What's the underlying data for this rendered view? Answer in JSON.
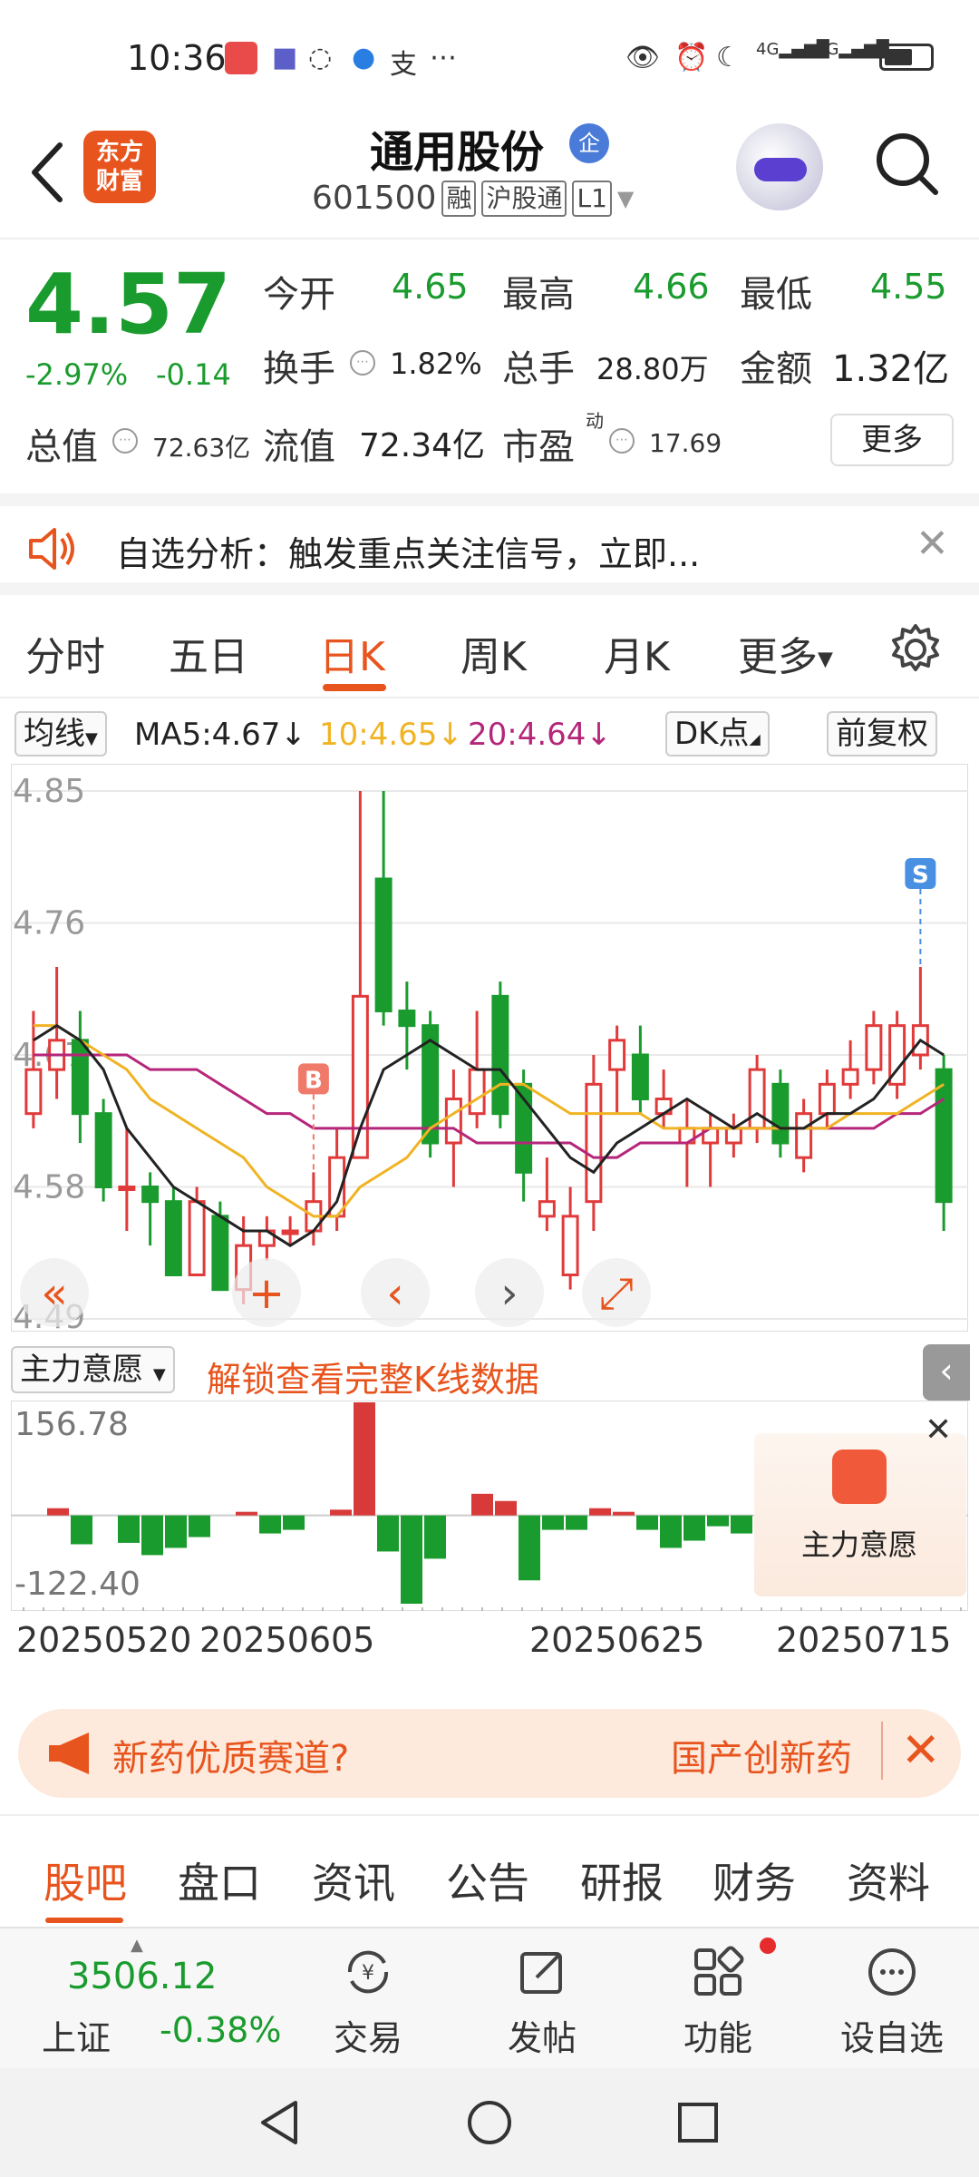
{
  "status_bar": {
    "time": "10:36",
    "left_icons": [
      "huawei-app-icon",
      "teams-icon",
      "loading-icon",
      "browser-icon",
      "alipay-icon",
      "more-dots-icon"
    ],
    "right_icons": [
      "eye-icon",
      "alarm-icon",
      "moon-icon",
      "signal-4g-icon",
      "signal-5g-icon",
      "battery-icon"
    ],
    "network1": "4G",
    "network2": "5G"
  },
  "header": {
    "logo_line1": "东方",
    "logo_line2": "财富",
    "stock_name": "通用股份",
    "badge": "企",
    "code": "601500",
    "tags": [
      "融",
      "沪股通",
      "L1"
    ]
  },
  "quote": {
    "price": "4.57",
    "change_pct": "-2.97%",
    "change_abs": "-0.14",
    "open_label": "今开",
    "open": "4.65",
    "high_label": "最高",
    "high": "4.66",
    "low_label": "最低",
    "low": "4.55",
    "turnover_label": "换手",
    "turnover": "1.82%",
    "volume_label": "总手",
    "volume": "28.80万",
    "amount_label": "金额",
    "amount": "1.32亿",
    "mktcap_label": "总值",
    "mktcap": "72.63亿",
    "float_label": "流值",
    "float": "72.34亿",
    "pe_label": "市盈",
    "pe_sup": "动",
    "pe": "17.69",
    "more_button": "更多"
  },
  "notice": {
    "text": "自选分析：触发重点关注信号，立即..."
  },
  "chart_tabs": {
    "items": [
      "分时",
      "五日",
      "日K",
      "周K",
      "月K",
      "更多"
    ],
    "active": "日K"
  },
  "ma_row": {
    "selector": "均线",
    "ma5": "MA5:4.67↓",
    "ma10": "10:4.65↓",
    "ma20": "20:4.64↓",
    "dk": "DK点",
    "adjust": "前复权",
    "ma10_color": "#f0b323",
    "ma20_color": "#b5267a"
  },
  "chart_data": {
    "type": "candlestick",
    "y_ticks": [
      "4.85",
      "4.76",
      "4.67",
      "4.58",
      "4.49"
    ],
    "ylim": [
      4.49,
      4.85
    ],
    "up_color": "#e03a3a",
    "down_color": "#1a9b2e",
    "signals": [
      {
        "label": "B",
        "index": 12
      },
      {
        "label": "S",
        "index": 38
      }
    ],
    "candles": [
      [
        4.63,
        4.66,
        4.7,
        4.62
      ],
      [
        4.66,
        4.68,
        4.73,
        4.64
      ],
      [
        4.68,
        4.63,
        4.7,
        4.61
      ],
      [
        4.63,
        4.58,
        4.64,
        4.57
      ],
      [
        4.58,
        4.58,
        4.62,
        4.55
      ],
      [
        4.58,
        4.57,
        4.59,
        4.54
      ],
      [
        4.57,
        4.52,
        4.58,
        4.52
      ],
      [
        4.52,
        4.57,
        4.58,
        4.52
      ],
      [
        4.56,
        4.51,
        4.57,
        4.51
      ],
      [
        4.51,
        4.54,
        4.56,
        4.5
      ],
      [
        4.54,
        4.55,
        4.56,
        4.53
      ],
      [
        4.55,
        4.55,
        4.56,
        4.54
      ],
      [
        4.55,
        4.57,
        4.59,
        4.54
      ],
      [
        4.56,
        4.6,
        4.62,
        4.55
      ],
      [
        4.6,
        4.71,
        4.85,
        4.6
      ],
      [
        4.79,
        4.7,
        4.85,
        4.69
      ],
      [
        4.7,
        4.69,
        4.72,
        4.66
      ],
      [
        4.69,
        4.61,
        4.7,
        4.6
      ],
      [
        4.61,
        4.64,
        4.66,
        4.58
      ],
      [
        4.63,
        4.66,
        4.7,
        4.62
      ],
      [
        4.71,
        4.63,
        4.72,
        4.62
      ],
      [
        4.65,
        4.59,
        4.66,
        4.57
      ],
      [
        4.56,
        4.57,
        4.6,
        4.55
      ],
      [
        4.52,
        4.56,
        4.58,
        4.51
      ],
      [
        4.57,
        4.65,
        4.67,
        4.55
      ],
      [
        4.66,
        4.68,
        4.69,
        4.63
      ],
      [
        4.67,
        4.64,
        4.69,
        4.63
      ],
      [
        4.63,
        4.64,
        4.66,
        4.62
      ],
      [
        4.61,
        4.62,
        4.64,
        4.58
      ],
      [
        4.61,
        4.62,
        4.63,
        4.58
      ],
      [
        4.61,
        4.62,
        4.63,
        4.6
      ],
      [
        4.62,
        4.66,
        4.67,
        4.61
      ],
      [
        4.65,
        4.61,
        4.66,
        4.6
      ],
      [
        4.6,
        4.63,
        4.64,
        4.59
      ],
      [
        4.63,
        4.65,
        4.66,
        4.62
      ],
      [
        4.65,
        4.66,
        4.68,
        4.64
      ],
      [
        4.66,
        4.69,
        4.7,
        4.65
      ],
      [
        4.65,
        4.69,
        4.7,
        4.64
      ],
      [
        4.67,
        4.69,
        4.73,
        4.66
      ],
      [
        4.66,
        4.57,
        4.67,
        4.55
      ]
    ],
    "ma5": [
      4.68,
      4.69,
      4.68,
      4.66,
      4.62,
      4.6,
      4.58,
      4.57,
      4.56,
      4.55,
      4.55,
      4.54,
      4.55,
      4.57,
      4.62,
      4.66,
      4.67,
      4.68,
      4.67,
      4.66,
      4.66,
      4.64,
      4.62,
      4.6,
      4.59,
      4.61,
      4.62,
      4.63,
      4.64,
      4.63,
      4.62,
      4.63,
      4.62,
      4.62,
      4.63,
      4.63,
      4.64,
      4.66,
      4.68,
      4.67
    ],
    "ma10": [
      4.69,
      4.69,
      4.68,
      4.67,
      4.66,
      4.64,
      4.63,
      4.62,
      4.61,
      4.6,
      4.58,
      4.57,
      4.56,
      4.56,
      4.58,
      4.59,
      4.6,
      4.62,
      4.63,
      4.64,
      4.65,
      4.65,
      4.64,
      4.63,
      4.63,
      4.63,
      4.63,
      4.62,
      4.62,
      4.62,
      4.62,
      4.62,
      4.62,
      4.62,
      4.62,
      4.63,
      4.63,
      4.63,
      4.64,
      4.65
    ],
    "ma20": [
      4.67,
      4.67,
      4.67,
      4.67,
      4.67,
      4.66,
      4.66,
      4.66,
      4.65,
      4.64,
      4.63,
      4.63,
      4.62,
      4.62,
      4.62,
      4.62,
      4.62,
      4.62,
      4.62,
      4.61,
      4.61,
      4.61,
      4.61,
      4.61,
      4.6,
      4.6,
      4.61,
      4.61,
      4.61,
      4.62,
      4.62,
      4.62,
      4.62,
      4.62,
      4.62,
      4.62,
      4.62,
      4.63,
      4.63,
      4.64
    ]
  },
  "indicator": {
    "selector": "主力意愿",
    "unlock_text": "解锁查看完整K线数据",
    "max_label": "156.78",
    "min_label": "-122.40",
    "values": [
      0,
      10,
      -40,
      0,
      -38,
      -55,
      -45,
      -30,
      0,
      5,
      -25,
      -20,
      0,
      8,
      156.78,
      -50,
      -122.4,
      -60,
      0,
      30,
      20,
      -90,
      -20,
      -20,
      10,
      5,
      -20,
      -45,
      -35,
      -15,
      -25,
      5
    ],
    "ad_label": "主力意愿"
  },
  "dates": [
    "20250520",
    "20250605",
    "20250625",
    "20250715"
  ],
  "promo": {
    "left": "新药优质赛道?",
    "right": "国产创新药"
  },
  "bottom_tabs": {
    "items": [
      "股吧",
      "盘口",
      "资讯",
      "公告",
      "研报",
      "财务",
      "资料"
    ],
    "active": "股吧"
  },
  "bottom_bar": {
    "index_value": "3506.12",
    "index_name": "上证",
    "index_change": "-0.38%",
    "items": [
      {
        "label": "交易",
        "icon": "yen-exchange-icon"
      },
      {
        "label": "发帖",
        "icon": "edit-post-icon"
      },
      {
        "label": "功能",
        "icon": "grid-apps-icon"
      },
      {
        "label": "设自选",
        "icon": "more-circle-icon"
      }
    ]
  }
}
